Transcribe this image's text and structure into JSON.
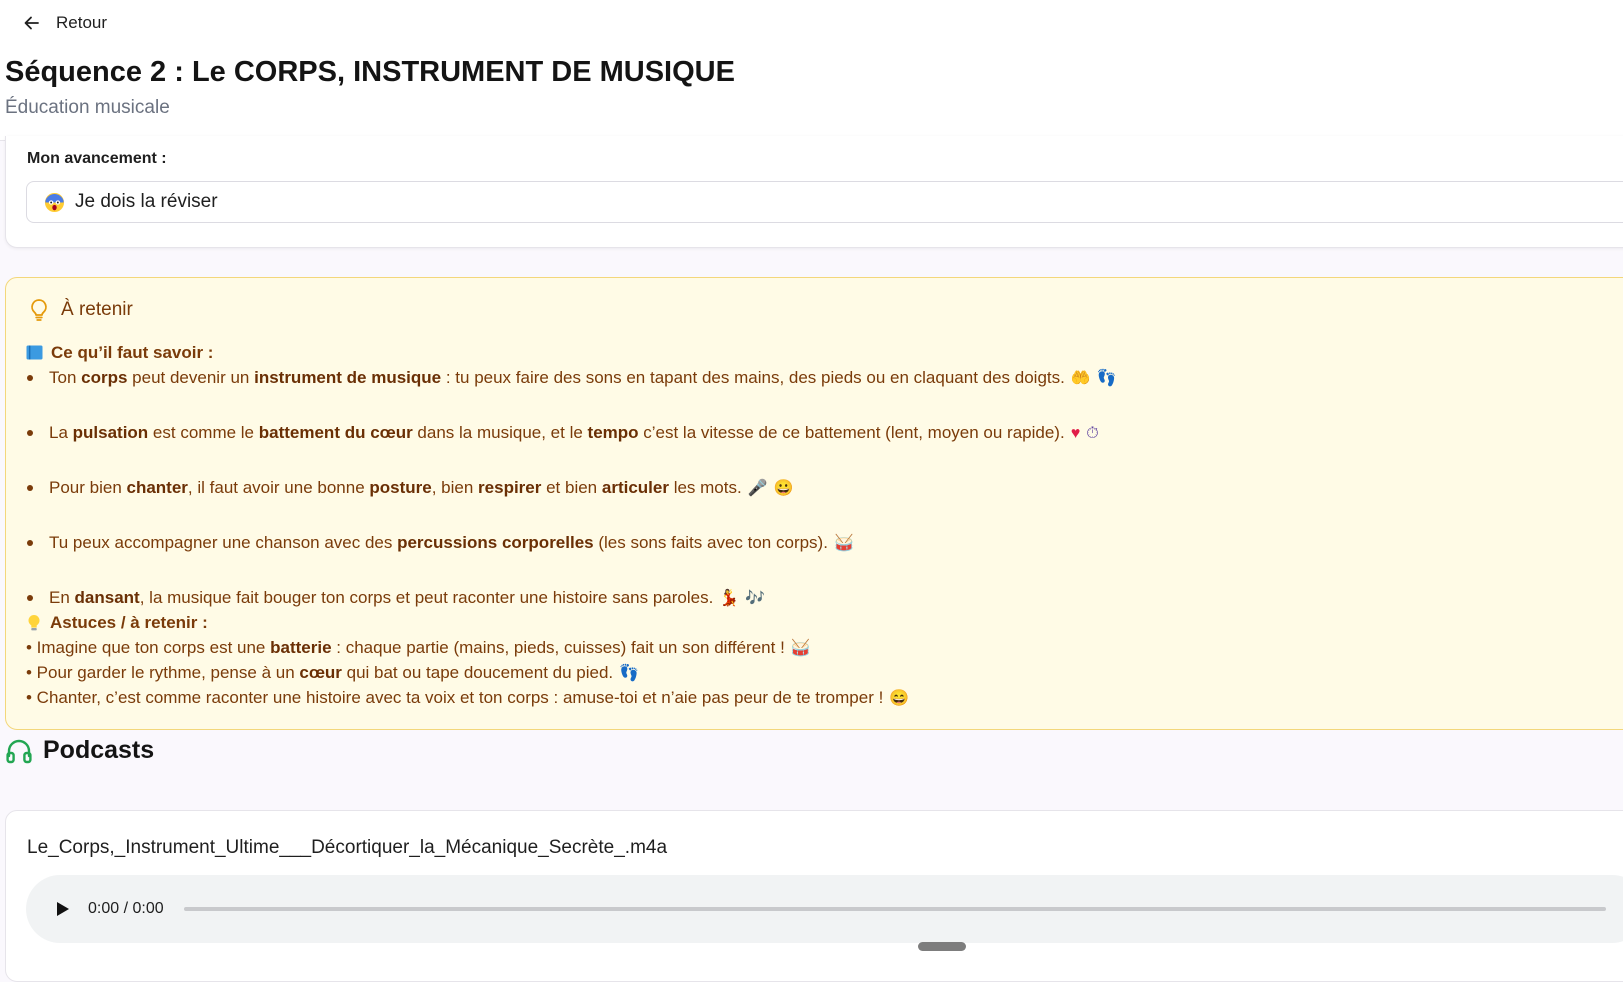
{
  "header": {
    "back_label": "Retour",
    "title": "Séquence 2 : Le CORPS, INSTRUMENT DE MUSIQUE",
    "subtitle": "Éducation musicale"
  },
  "progress": {
    "label": "Mon avancement :",
    "status_icon": "face-screaming-emoji",
    "value": "Je dois la réviser"
  },
  "retenir": {
    "title": "À retenir",
    "section1_title": "Ce qu’il faut savoir :",
    "bullets": [
      {
        "p1": "Ton ",
        "b1": "corps",
        "p2": " peut devenir un ",
        "b2": "instrument de musique",
        "p3": " : tu peux faire des sons en tapant des mains, des pieds ou en claquant des doigts.",
        "emojis": [
          "🤲",
          "👣"
        ]
      },
      {
        "p1": "La ",
        "b1": "pulsation",
        "p2": " est comme le ",
        "b2": "battement du cœur",
        "p3": " dans la musique, et le ",
        "b3": "tempo",
        "p4": " c’est la vitesse de ce battement (lent, moyen ou rapide).",
        "emojis": [
          "♥",
          "⏱"
        ]
      },
      {
        "p1": "Pour bien ",
        "b1": "chanter",
        "p2": ", il faut avoir une bonne ",
        "b2": "posture",
        "p3": ", bien ",
        "b3": "respirer",
        "p4": " et bien ",
        "b4": "articuler",
        "p5": " les mots.",
        "emojis": [
          "🎤",
          "😀"
        ]
      },
      {
        "p1": "Tu peux accompagner une chanson avec des ",
        "b1": "percussions corporelles",
        "p2": " (les sons faits avec ton corps).",
        "emojis": [
          "🥁"
        ]
      },
      {
        "p1": "En ",
        "b1": "dansant",
        "p2": ", la musique fait bouger ton corps et peut raconter une histoire sans paroles.",
        "emojis": [
          "💃",
          "🎶"
        ]
      }
    ],
    "section2_title": "Astuces / à retenir :",
    "tips": [
      {
        "p1": "• Imagine que ton corps est une ",
        "b1": "batterie",
        "p2": " : chaque partie (mains, pieds, cuisses) fait un son différent !",
        "emojis": [
          "🥁"
        ]
      },
      {
        "p1": "• Pour garder le rythme, pense à un ",
        "b1": "cœur",
        "p2": " qui bat ou tape doucement du pied.",
        "emojis": [
          "👣"
        ]
      },
      {
        "p1": "• Chanter, c’est comme raconter une histoire avec ta voix et ton corps : amuse-toi et n’aie pas peur de te tromper !",
        "emojis": [
          "😄"
        ]
      }
    ]
  },
  "podcasts": {
    "title": "Podcasts",
    "items": [
      {
        "filename": "Le_Corps,_Instrument_Ultime___Décortiquer_la_Mécanique_Secrète_.m4a",
        "time": "0:00 / 0:00",
        "progress": 0
      }
    ]
  },
  "colors": {
    "accent_green": "#22a652",
    "retenir_bg": "#fffbe6",
    "retenir_border": "#f3d77b",
    "retenir_text": "#7a3b0a"
  }
}
